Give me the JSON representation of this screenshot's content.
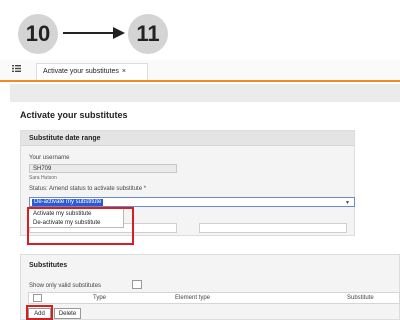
{
  "steps": {
    "from": "10",
    "to": "11"
  },
  "tabs": {
    "active_label": "Activate your substitutes",
    "close_glyph": "×"
  },
  "page": {
    "title": "Activate your substitutes"
  },
  "date_range_panel": {
    "heading": "Substitute date range",
    "username_label": "Your username",
    "username_value": "SH709",
    "user_fullname": "Sara Hutson",
    "status_label": "Status: Amend status to activate substitute *",
    "status_value": "De-activate my substitute",
    "status_options": [
      "Activate my substitute",
      "De-activate my substitute"
    ]
  },
  "substitutes_panel": {
    "heading": "Substitutes",
    "show_valid_label": "Show only valid substitutes",
    "columns": [
      "Type",
      "Element type",
      "Substitute"
    ],
    "add_label": "Add",
    "delete_label": "Delete"
  },
  "colors": {
    "accent_orange": "#f08c1e",
    "highlight_red": "#d42020",
    "selection_blue": "#2a5bd7"
  }
}
